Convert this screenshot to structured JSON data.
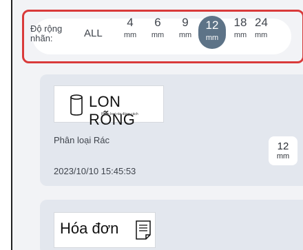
{
  "filter": {
    "label_line1": "Độ rộng",
    "label_line2": "nhãn:",
    "all_label": "ALL",
    "options": [
      {
        "value": "4",
        "unit": "mm"
      },
      {
        "value": "6",
        "unit": "mm"
      },
      {
        "value": "9",
        "unit": "mm"
      },
      {
        "value": "12",
        "unit": "mm"
      },
      {
        "value": "18",
        "unit": "mm"
      },
      {
        "value": "24",
        "unit": "mm"
      }
    ],
    "selected_value": "12",
    "accent_color": "#5d7387",
    "highlight_border_color": "#d93a3a"
  },
  "cards": [
    {
      "label_title": "LON RỖNG",
      "label_subtitle": "Phân loại rác đúng cách",
      "label_icon": "can-icon",
      "category": "Phân loại Rác",
      "datetime": "2023/10/10 15:45:53",
      "size_value": "12",
      "size_unit": "mm"
    },
    {
      "label_title": "Hóa đơn",
      "label_icon": "receipt-icon"
    }
  ]
}
